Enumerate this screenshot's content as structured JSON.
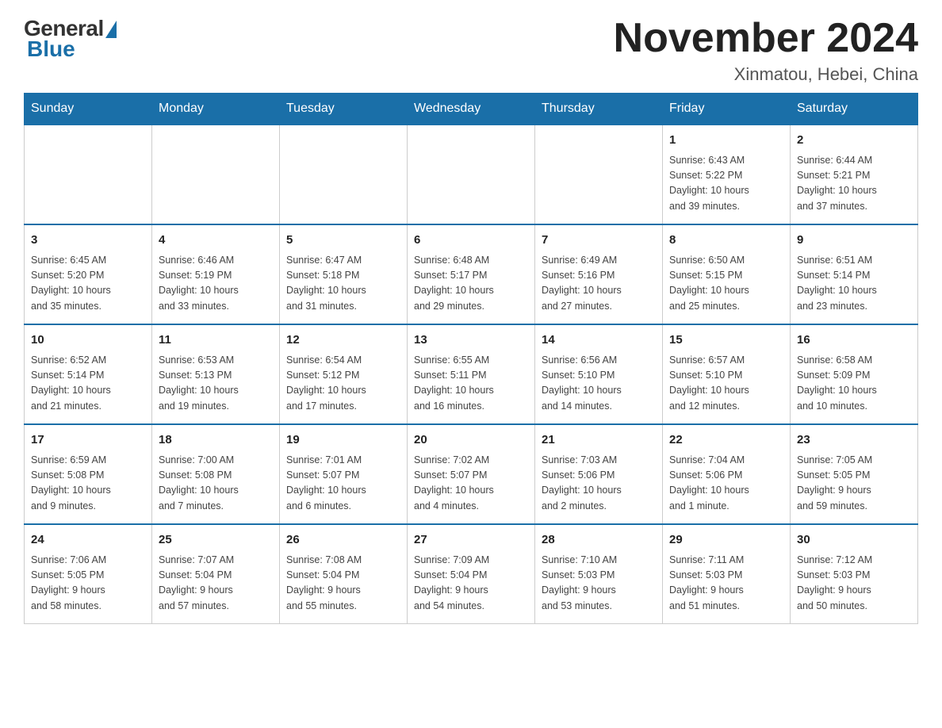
{
  "logo": {
    "general": "General",
    "blue": "Blue"
  },
  "title": "November 2024",
  "location": "Xinmatou, Hebei, China",
  "days_of_week": [
    "Sunday",
    "Monday",
    "Tuesday",
    "Wednesday",
    "Thursday",
    "Friday",
    "Saturday"
  ],
  "weeks": [
    [
      {
        "day": "",
        "info": ""
      },
      {
        "day": "",
        "info": ""
      },
      {
        "day": "",
        "info": ""
      },
      {
        "day": "",
        "info": ""
      },
      {
        "day": "",
        "info": ""
      },
      {
        "day": "1",
        "info": "Sunrise: 6:43 AM\nSunset: 5:22 PM\nDaylight: 10 hours\nand 39 minutes."
      },
      {
        "day": "2",
        "info": "Sunrise: 6:44 AM\nSunset: 5:21 PM\nDaylight: 10 hours\nand 37 minutes."
      }
    ],
    [
      {
        "day": "3",
        "info": "Sunrise: 6:45 AM\nSunset: 5:20 PM\nDaylight: 10 hours\nand 35 minutes."
      },
      {
        "day": "4",
        "info": "Sunrise: 6:46 AM\nSunset: 5:19 PM\nDaylight: 10 hours\nand 33 minutes."
      },
      {
        "day": "5",
        "info": "Sunrise: 6:47 AM\nSunset: 5:18 PM\nDaylight: 10 hours\nand 31 minutes."
      },
      {
        "day": "6",
        "info": "Sunrise: 6:48 AM\nSunset: 5:17 PM\nDaylight: 10 hours\nand 29 minutes."
      },
      {
        "day": "7",
        "info": "Sunrise: 6:49 AM\nSunset: 5:16 PM\nDaylight: 10 hours\nand 27 minutes."
      },
      {
        "day": "8",
        "info": "Sunrise: 6:50 AM\nSunset: 5:15 PM\nDaylight: 10 hours\nand 25 minutes."
      },
      {
        "day": "9",
        "info": "Sunrise: 6:51 AM\nSunset: 5:14 PM\nDaylight: 10 hours\nand 23 minutes."
      }
    ],
    [
      {
        "day": "10",
        "info": "Sunrise: 6:52 AM\nSunset: 5:14 PM\nDaylight: 10 hours\nand 21 minutes."
      },
      {
        "day": "11",
        "info": "Sunrise: 6:53 AM\nSunset: 5:13 PM\nDaylight: 10 hours\nand 19 minutes."
      },
      {
        "day": "12",
        "info": "Sunrise: 6:54 AM\nSunset: 5:12 PM\nDaylight: 10 hours\nand 17 minutes."
      },
      {
        "day": "13",
        "info": "Sunrise: 6:55 AM\nSunset: 5:11 PM\nDaylight: 10 hours\nand 16 minutes."
      },
      {
        "day": "14",
        "info": "Sunrise: 6:56 AM\nSunset: 5:10 PM\nDaylight: 10 hours\nand 14 minutes."
      },
      {
        "day": "15",
        "info": "Sunrise: 6:57 AM\nSunset: 5:10 PM\nDaylight: 10 hours\nand 12 minutes."
      },
      {
        "day": "16",
        "info": "Sunrise: 6:58 AM\nSunset: 5:09 PM\nDaylight: 10 hours\nand 10 minutes."
      }
    ],
    [
      {
        "day": "17",
        "info": "Sunrise: 6:59 AM\nSunset: 5:08 PM\nDaylight: 10 hours\nand 9 minutes."
      },
      {
        "day": "18",
        "info": "Sunrise: 7:00 AM\nSunset: 5:08 PM\nDaylight: 10 hours\nand 7 minutes."
      },
      {
        "day": "19",
        "info": "Sunrise: 7:01 AM\nSunset: 5:07 PM\nDaylight: 10 hours\nand 6 minutes."
      },
      {
        "day": "20",
        "info": "Sunrise: 7:02 AM\nSunset: 5:07 PM\nDaylight: 10 hours\nand 4 minutes."
      },
      {
        "day": "21",
        "info": "Sunrise: 7:03 AM\nSunset: 5:06 PM\nDaylight: 10 hours\nand 2 minutes."
      },
      {
        "day": "22",
        "info": "Sunrise: 7:04 AM\nSunset: 5:06 PM\nDaylight: 10 hours\nand 1 minute."
      },
      {
        "day": "23",
        "info": "Sunrise: 7:05 AM\nSunset: 5:05 PM\nDaylight: 9 hours\nand 59 minutes."
      }
    ],
    [
      {
        "day": "24",
        "info": "Sunrise: 7:06 AM\nSunset: 5:05 PM\nDaylight: 9 hours\nand 58 minutes."
      },
      {
        "day": "25",
        "info": "Sunrise: 7:07 AM\nSunset: 5:04 PM\nDaylight: 9 hours\nand 57 minutes."
      },
      {
        "day": "26",
        "info": "Sunrise: 7:08 AM\nSunset: 5:04 PM\nDaylight: 9 hours\nand 55 minutes."
      },
      {
        "day": "27",
        "info": "Sunrise: 7:09 AM\nSunset: 5:04 PM\nDaylight: 9 hours\nand 54 minutes."
      },
      {
        "day": "28",
        "info": "Sunrise: 7:10 AM\nSunset: 5:03 PM\nDaylight: 9 hours\nand 53 minutes."
      },
      {
        "day": "29",
        "info": "Sunrise: 7:11 AM\nSunset: 5:03 PM\nDaylight: 9 hours\nand 51 minutes."
      },
      {
        "day": "30",
        "info": "Sunrise: 7:12 AM\nSunset: 5:03 PM\nDaylight: 9 hours\nand 50 minutes."
      }
    ]
  ]
}
